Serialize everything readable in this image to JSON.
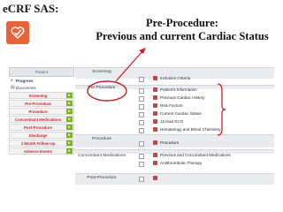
{
  "slide": {
    "title": "eCRF SAS:",
    "headline_line1": "Pre-Procedure:",
    "headline_line2": "Previous and current Cardiac Status"
  },
  "nav": {
    "header": "Patient",
    "links": [
      {
        "icon": "search-icon",
        "label": "Progress"
      },
      {
        "icon": "document-icon",
        "label": "Documents"
      }
    ],
    "buttons": [
      "Screening",
      "Pre-Procedure",
      "Procedure",
      "Concomitant Medications",
      "Post-Procedure",
      "Discharge",
      "1 Month Follow-Up",
      "Adverse Events"
    ]
  },
  "crf": {
    "sections": [
      {
        "label": "Screening",
        "forms": [
          "Inclusion Criteria"
        ]
      },
      {
        "label": "Pre-Procedure",
        "forms": [
          "Patient's Information",
          "Previous Cardiac History",
          "Risk Factors",
          "Current Cardiac Status",
          "12 lead ECG",
          "Hematology and Blood Chemistry"
        ]
      },
      {
        "label": "Procedure",
        "forms": [
          "Procedure"
        ]
      },
      {
        "label": "Concomitant Medications",
        "forms": [
          "Previous and Concomitant Medications",
          "Antithrombotic Therapy"
        ]
      },
      {
        "label": "Post-Procedure",
        "forms": [
          ""
        ]
      }
    ]
  },
  "colors": {
    "accent_logo": "#e8623a",
    "annotation_red": "#cc1f2a",
    "nav_text_red": "#cc1f2a",
    "arrow_green": "#7cb518"
  }
}
